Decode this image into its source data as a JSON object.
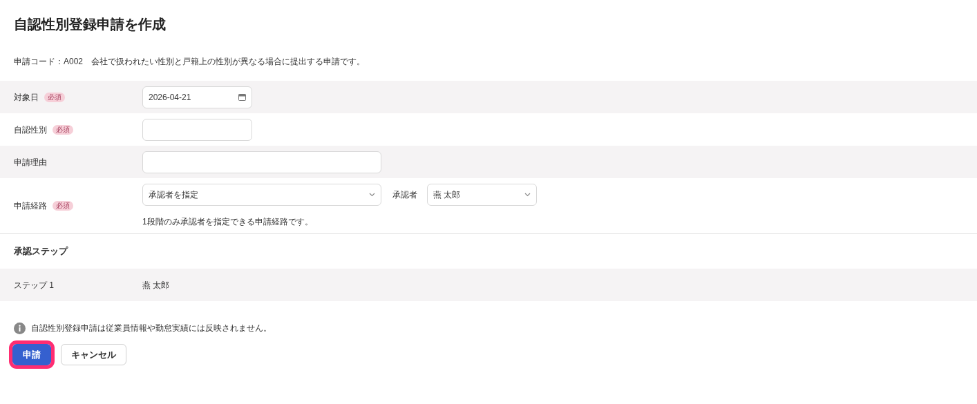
{
  "title": "自認性別登録申請を作成",
  "description": "申請コード：A002　会社で扱われたい性別と戸籍上の性別が異なる場合に提出する申請です。",
  "fields": [
    {
      "kind": "date",
      "label": "対象日",
      "required_badge": "必須",
      "value": "2026-04-21"
    },
    {
      "kind": "short_text",
      "label": "自認性別",
      "required_badge": "必須"
    },
    {
      "kind": "long_text",
      "label": "申請理由"
    },
    {
      "kind": "route",
      "label": "申請経路",
      "required_badge": "必須",
      "route_value": "承認者を指定",
      "approver_label": "承認者",
      "approver_value": "燕 太郎",
      "note": "1段階のみ承認者を指定できる申請経路です。"
    }
  ],
  "steps_heading": "承認ステップ",
  "steps": [
    {
      "label": "ステップ 1",
      "approver": "燕 太郎"
    }
  ],
  "info": "自認性別登録申請は従業員情報や勤怠実績には反映されません。",
  "buttons": [
    {
      "kind": "primary",
      "label": "申請",
      "highlighted": true
    },
    {
      "kind": "secondary",
      "label": "キャンセル",
      "highlighted": false
    }
  ]
}
